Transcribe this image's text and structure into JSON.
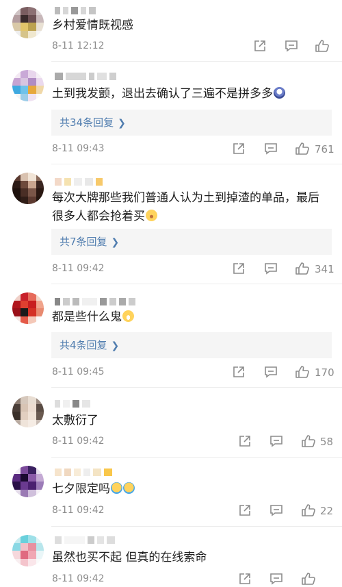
{
  "comments": [
    {
      "text": "乡村爱情既视感",
      "time": "8-11 12:12",
      "replies": "",
      "likes": ""
    },
    {
      "text": "土到我发颤，退出去确认了三遍不是拼多多",
      "time": "8-11 09:43",
      "replies": "共34条回复",
      "likes": "761"
    },
    {
      "text": "每次大牌那些我们普通人认为土到掉渣的单品，最后很多人都会抢着买",
      "time": "8-11 09:42",
      "replies": "共7条回复",
      "likes": "341"
    },
    {
      "text": "都是些什么鬼",
      "time": "8-11 09:45",
      "replies": "共4条回复",
      "likes": "170"
    },
    {
      "text": "太敷衍了",
      "time": "8-11 09:42",
      "replies": "",
      "likes": "58"
    },
    {
      "text": "七夕限定吗",
      "time": "8-11 09:42",
      "replies": "",
      "likes": "22"
    },
    {
      "text": "虽然也买不起 但真的在线索命",
      "time": "8-11 09:42",
      "replies": "",
      "likes": ""
    }
  ],
  "icons": {
    "share": "share-icon",
    "comment": "comment-icon",
    "like": "thumbs-up-icon",
    "reply_chevron": "chevron-right-icon"
  },
  "colors": {
    "reply_link": "#507daf",
    "meta_text": "#8c8c8c",
    "reply_bg": "#f5f5f5"
  }
}
